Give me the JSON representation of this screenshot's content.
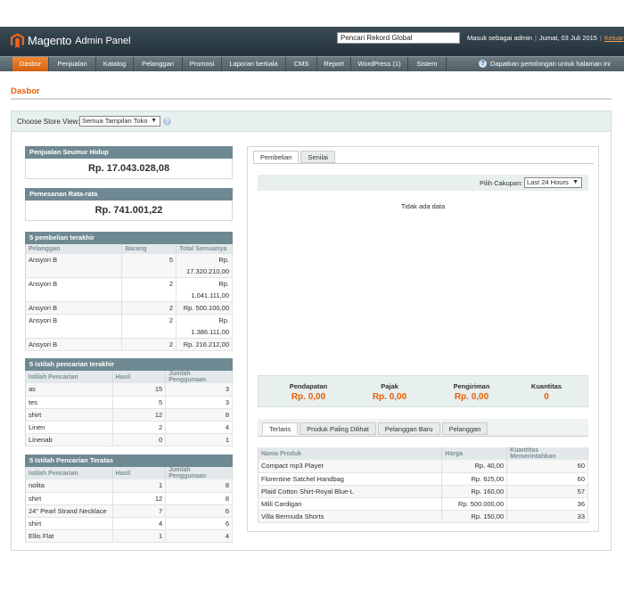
{
  "header": {
    "brand": "Magento",
    "sub": "Admin Panel",
    "search_value": "Pencari Rekord Global",
    "user_text": "Masuk sebagai admin",
    "date_text": "Jumat, 03 Juli 2015",
    "logout": "Keluar"
  },
  "nav": {
    "items": [
      "Dasbor",
      "Penjualan",
      "Katalog",
      "Pelanggan",
      "Promosi",
      "Laporan berkala",
      "CMS",
      "Report",
      "WordPress (1)",
      "Sistem"
    ],
    "help": "Dapatkan pertolongan untuk halaman ini"
  },
  "page": {
    "title": "Dasbor",
    "store_label": "Choose Store View:",
    "store_value": "Semua Tampilan Toko"
  },
  "lifetime": {
    "title": "Penjualan Seumur Hidup",
    "value": "Rp. 17.043.028,08"
  },
  "average": {
    "title": "Pemesanan Rata-rata",
    "value": "Rp. 741.001,22"
  },
  "last_orders": {
    "title": "5 pembelian terakhir",
    "columns": [
      "Pelanggan",
      "Barang",
      "Total Semuanya"
    ],
    "rows": [
      [
        "Ansyori B",
        "5",
        "Rp. 17.320.210,00"
      ],
      [
        "Ansyori B",
        "2",
        "Rp. 1.041.111,00"
      ],
      [
        "Ansyori B",
        "2",
        "Rp. 500.100,00"
      ],
      [
        "Ansyori B",
        "2",
        "Rp. 1.386.111,00"
      ],
      [
        "Ansyori B",
        "2",
        "Rp. 216.212,00"
      ]
    ]
  },
  "last_search": {
    "title": "5 istilah pencarian terakhir",
    "columns": [
      "Istilah Pencarian",
      "Hasil",
      "Jumlah Penggunaan"
    ],
    "rows": [
      [
        "as",
        "15",
        "3"
      ],
      [
        "tes",
        "5",
        "3"
      ],
      [
        "shirt",
        "12",
        "8"
      ],
      [
        "Linen",
        "2",
        "4"
      ],
      [
        "Linenab",
        "0",
        "1"
      ]
    ]
  },
  "top_search": {
    "title": "5 Istilah Pencarian Teratas",
    "columns": [
      "Istilah Pencarian",
      "Hasil",
      "Jumlah Penggunaan"
    ],
    "rows": [
      [
        "nolita",
        "1",
        "8"
      ],
      [
        "shirt",
        "12",
        "8"
      ],
      [
        "24\" Pearl Strand Necklace",
        "7",
        "6"
      ],
      [
        "shirt",
        "4",
        "6"
      ],
      [
        "Ellis Flat",
        "1",
        "4"
      ]
    ]
  },
  "chart_panel": {
    "tabs": [
      "Pembelian",
      "Senilai"
    ],
    "range_label": "Pilih Cakupan:",
    "range_value": "Last 24 Hours",
    "no_data": "Tidak ada data"
  },
  "totals": [
    {
      "label": "Pendapatan",
      "value": "Rp. 0,00"
    },
    {
      "label": "Pajak",
      "value": "Rp. 0,00"
    },
    {
      "label": "Pengiriman",
      "value": "Rp. 0,00"
    },
    {
      "label": "Kuantitas",
      "value": "0"
    }
  ],
  "products": {
    "tabs": [
      "Terlaris",
      "Produk Paling Dilihat",
      "Pelanggan Baru",
      "Pelanggan"
    ],
    "columns": [
      "Nama Produk",
      "Harga",
      "Kuantitas Memerintahkan"
    ],
    "rows": [
      [
        "Compact mp3 Player",
        "Rp. 40,00",
        "60"
      ],
      [
        "Florentine Satchel Handbag",
        "Rp. 625,00",
        "60"
      ],
      [
        "Plaid Cotton Shirt-Royal Blue-L",
        "Rp. 160,00",
        "57"
      ],
      [
        "Milli Cardigan",
        "Rp. 500.000,00",
        "36"
      ],
      [
        "Villa Bermuda Shorts",
        "Rp. 150,00",
        "33"
      ]
    ]
  }
}
